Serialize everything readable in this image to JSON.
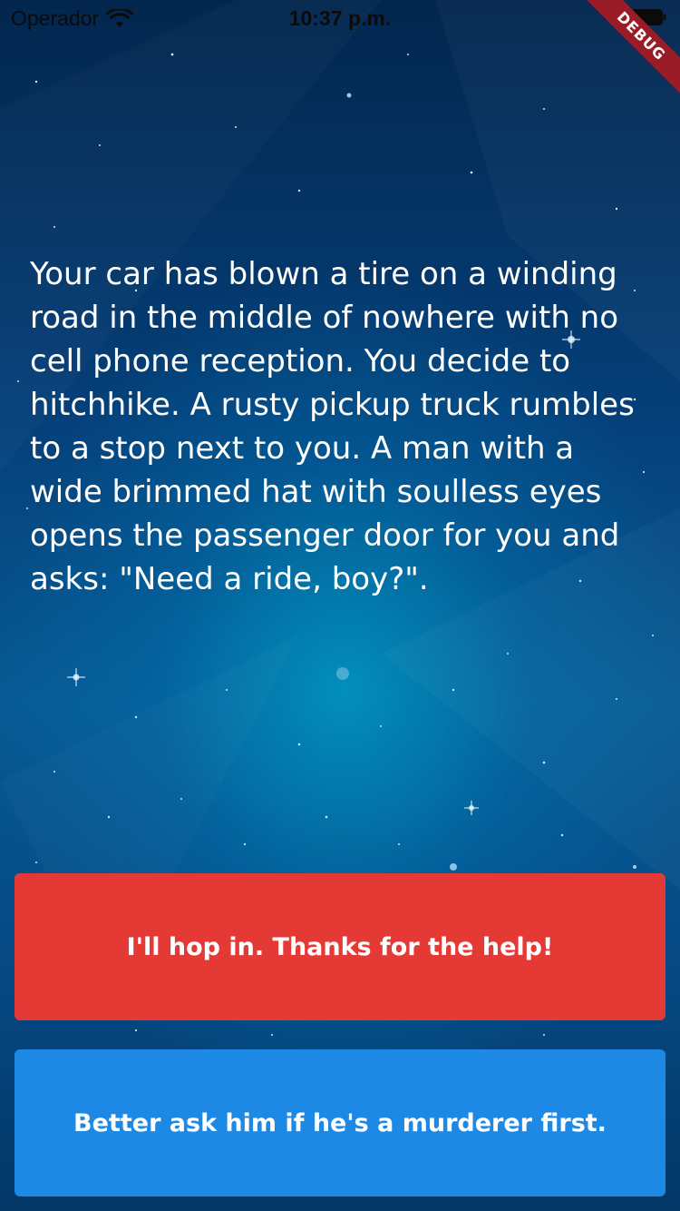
{
  "status_bar": {
    "carrier": "Operador",
    "time": "10:37 p.m.",
    "wifi_icon": "wifi-icon",
    "battery_icon": "battery-icon"
  },
  "debug_banner": "DEBUG",
  "story": {
    "text": "Your car has blown a tire on a winding road in the middle of nowhere with no cell phone reception. You decide to hitchhike. A rusty pickup truck rumbles to a stop next to you. A man with a wide brimmed hat with soulless eyes opens the passenger door for you and asks: \"Need a ride, boy?\"."
  },
  "choices": {
    "choice1_label": "I'll hop in. Thanks for the help!",
    "choice2_label": "Better ask him if he's a murderer first."
  },
  "colors": {
    "choice1": "#e53935",
    "choice2": "#1e88e5",
    "debug": "#9a1c26"
  }
}
